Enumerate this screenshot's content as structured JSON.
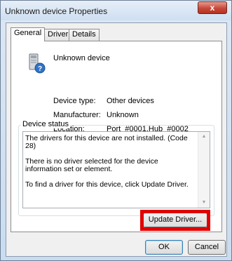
{
  "window": {
    "title": "Unknown device Properties",
    "close_label": "x"
  },
  "tabs": [
    {
      "label": "General",
      "active": true
    },
    {
      "label": "Driver",
      "active": false
    },
    {
      "label": "Details",
      "active": false
    }
  ],
  "device": {
    "name": "Unknown device",
    "icon": "unknown-device-icon",
    "properties": [
      {
        "label": "Device type:",
        "value": "Other devices"
      },
      {
        "label": "Manufacturer:",
        "value": "Unknown"
      },
      {
        "label": "Location:",
        "value": "Port_#0001.Hub_#0002"
      }
    ]
  },
  "status": {
    "group_title": "Device status",
    "text": "The drivers for this device are not installed. (Code 28)\n\nThere is no driver selected for the device information set or element.\n\nTo find a driver for this device, click Update Driver."
  },
  "buttons": {
    "update_driver": "Update Driver...",
    "ok": "OK",
    "cancel": "Cancel"
  },
  "colors": {
    "highlight": "#e00000",
    "close_button": "#c7483a"
  }
}
